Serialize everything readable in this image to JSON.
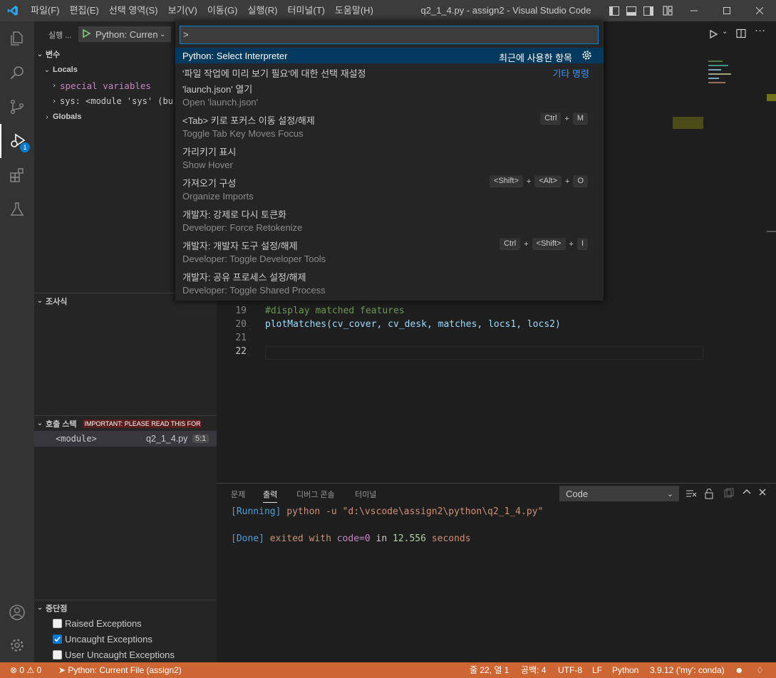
{
  "titlebar": {
    "menu": [
      "파일(F)",
      "편집(E)",
      "선택 영역(S)",
      "보기(V)",
      "이동(G)",
      "실행(R)",
      "터미널(T)",
      "도움말(H)"
    ],
    "title": "q2_1_4.py - assign2 - Visual Studio Code"
  },
  "activitybar": {
    "debug_badge": "1"
  },
  "sidebar": {
    "run_label": "실행 ...",
    "config_name": "Python: Curren",
    "variables_header": "변수",
    "locals_label": "Locals",
    "special_variables": "special variables",
    "sys_row": "sys: <module 'sys' (bu",
    "globals_label": "Globals",
    "watch_header": "조사식",
    "callstack_header": "호출 스택",
    "callstack_notice": "IMPORTANT: PLEASE READ THIS FOR A...",
    "frame_name": "<module>",
    "frame_file": "q2_1_4.py",
    "frame_pos": "5:1",
    "breakpoints_header": "중단점",
    "breakpoints": [
      {
        "label": "Raised Exceptions",
        "checked": false
      },
      {
        "label": "Uncaught Exceptions",
        "checked": true
      },
      {
        "label": "User Uncaught Exceptions",
        "checked": false
      }
    ]
  },
  "editor": {
    "lines": [
      {
        "num": "19",
        "text": "#display matched features"
      },
      {
        "num": "20",
        "text": "plotMatches(cv_cover, cv_desk, matches, locs1, locs2)"
      },
      {
        "num": "21",
        "text": ""
      },
      {
        "num": "22",
        "text": ""
      }
    ]
  },
  "quickinput": {
    "value": ">",
    "recent_label": "최근에 사용한 항목",
    "other_label": "기타 명령",
    "items": [
      {
        "label": "Python: Select Interpreter",
        "detail": ""
      },
      {
        "label": "'파일 작업에 미리 보기 필요'에 대한 선택 재설정",
        "detail": ""
      },
      {
        "label": "'launch.json' 열기",
        "detail": "Open 'launch.json'"
      },
      {
        "label": "<Tab> 키로 포커스 이동 설정/해제",
        "detail": "Toggle Tab Key Moves Focus",
        "keys": [
          "Ctrl",
          "M"
        ]
      },
      {
        "label": "가리키기 표시",
        "detail": "Show Hover"
      },
      {
        "label": "가져오기 구성",
        "detail": "Organize Imports",
        "keys": [
          "<Shift>",
          "<Alt>",
          "O"
        ]
      },
      {
        "label": "개발자: 강제로 다시 토큰화",
        "detail": "Developer: Force Retokenize"
      },
      {
        "label": "개발자: 개발자 도구 설정/해제",
        "detail": "Developer: Toggle Developer Tools",
        "keys": [
          "Ctrl",
          "<Shift>",
          "I"
        ]
      },
      {
        "label": "개발자: 공유 프로세스 설정/해제",
        "detail": "Developer: Toggle Shared Process"
      }
    ]
  },
  "panel": {
    "tabs": [
      "문제",
      "출력",
      "디버그 콘솔",
      "터미널"
    ],
    "active_tab": "출력",
    "output_source": "Code",
    "output_lines": {
      "running_tag": "[Running]",
      "running_cmd": "python -u \"d:\\vscode\\assign2\\python\\q2_1_4.py\"",
      "done_tag": "[Done]",
      "done_a": "exited with",
      "done_code": "code=0",
      "done_b": "in",
      "done_time": "12.556",
      "done_c": "seconds"
    }
  },
  "statusbar": {
    "errors": "0",
    "warnings": "0",
    "debug_config": "Python: Current File (assign2)",
    "cursor": "줄 22, 열 1",
    "indent": "공백: 4",
    "encoding": "UTF-8",
    "eol": "LF",
    "language": "Python",
    "interpreter": "3.9.12 ('my': conda)"
  },
  "colors": {
    "statusbar": "#cc6633",
    "accent": "#007acc",
    "selection": "#04395e"
  }
}
